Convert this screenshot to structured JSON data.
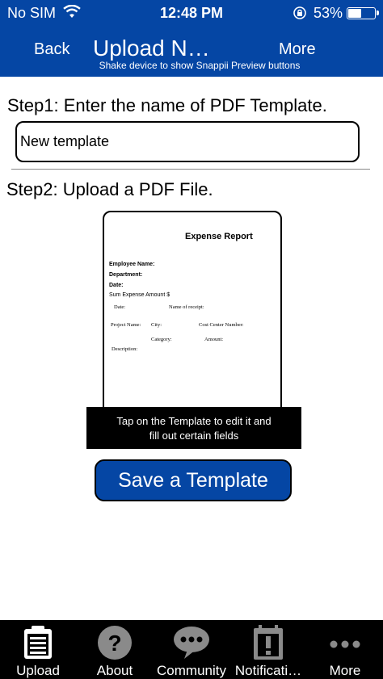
{
  "status_bar": {
    "carrier": "No SIM",
    "time": "12:48 PM",
    "battery_percent": "53%",
    "battery_level": 0.53
  },
  "nav": {
    "back_label": "Back",
    "title": "Upload N…",
    "more_label": "More",
    "hint": "Shake device to show Snappii Preview buttons"
  },
  "form": {
    "step1_label": "Step1: Enter the name of PDF Template.",
    "template_name_value": "New template",
    "step2_label": "Step2: Upload a PDF File.",
    "save_button_label": "Save a Template"
  },
  "pdf_preview": {
    "title": "Expense Report",
    "employee_name": "Employee Name:",
    "department": "Department:",
    "date": "Date:",
    "sum_expense": "Sum Expense Amount $",
    "date2": "Date:",
    "name_of_receipt": "Name of receipt:",
    "project_name": "Project Name:",
    "city": "City:",
    "cost_center": "Cost Center Number:",
    "category": "Category:",
    "amount": "Amount:",
    "description": "Description:"
  },
  "tooltip": {
    "line1": "Tap on the Template to edit it and",
    "line2": "fill out certain fields"
  },
  "tabs": [
    {
      "label": "Upload",
      "icon": "clipboard-icon",
      "active": true
    },
    {
      "label": "About",
      "icon": "question-icon",
      "active": false
    },
    {
      "label": "Community",
      "icon": "chat-bubble-icon",
      "active": false
    },
    {
      "label": "Notificati…",
      "icon": "exclamation-calendar-icon",
      "active": false
    },
    {
      "label": "More",
      "icon": "more-dots-icon",
      "active": false
    }
  ],
  "colors": {
    "brand_blue": "#0546a4",
    "tabbar_bg": "#000000",
    "inactive_icon": "#8a8a8a"
  }
}
